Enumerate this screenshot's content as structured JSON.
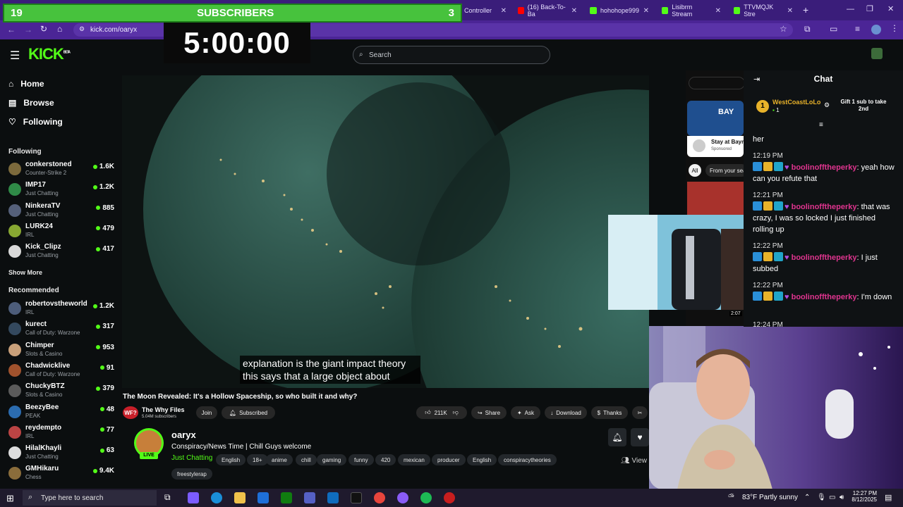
{
  "browser": {
    "tabs": [
      {
        "label": "Controller",
        "color": "#4a4a4a"
      },
      {
        "label": "(16) Back-To-Ba",
        "color": "#ff0000"
      },
      {
        "label": "hohohope999",
        "color": "#53fc18"
      },
      {
        "label": "Lisibrm Stream",
        "color": "#53fc18"
      },
      {
        "label": "TTVMQJK Stre",
        "color": "#53fc18"
      }
    ],
    "url": "kick.com/oaryx"
  },
  "overlay": {
    "sub_left": "19",
    "sub_title": "SUBSCRIBERS",
    "sub_right": "3",
    "timer": "5:00:00"
  },
  "kick": {
    "search_placeholder": "Search",
    "nav": [
      "Home",
      "Browse",
      "Following"
    ],
    "following_title": "Following",
    "following": [
      {
        "name": "conkerstoned",
        "game": "Counter-Strike 2",
        "viewers": "1.6K",
        "color": "#7c6a3c"
      },
      {
        "name": "IMP17",
        "game": "Just Chatting",
        "viewers": "1.2K",
        "color": "#2f8a47"
      },
      {
        "name": "NinkeraTV",
        "game": "Just Chatting",
        "viewers": "885",
        "color": "#55607a"
      },
      {
        "name": "LURK24",
        "game": "IRL",
        "viewers": "479",
        "color": "#88a832"
      },
      {
        "name": "Kick_Clipz",
        "game": "Just Chatting",
        "viewers": "417",
        "color": "#d9d9d9"
      }
    ],
    "show_more": "Show More",
    "recommended_title": "Recommended",
    "recommended": [
      {
        "name": "robertovstheworld",
        "game": "IRL",
        "viewers": "1.2K",
        "color": "#4d5d7a"
      },
      {
        "name": "kurect",
        "game": "Call of Duty: Warzone",
        "viewers": "317",
        "color": "#34495e"
      },
      {
        "name": "Chimper",
        "game": "Slots & Casino",
        "viewers": "953",
        "color": "#c9a07a"
      },
      {
        "name": "Chadwicklive",
        "game": "Call of Duty: Warzone",
        "viewers": "91",
        "color": "#a0522d"
      },
      {
        "name": "ChuckyBTZ",
        "game": "Slots & Casino",
        "viewers": "379",
        "color": "#5b5b5b"
      },
      {
        "name": "BeezyBee",
        "game": "PEAK",
        "viewers": "48",
        "color": "#2b6cb0"
      },
      {
        "name": "reydempto",
        "game": "IRL",
        "viewers": "77",
        "color": "#b44"
      },
      {
        "name": "HilalKhayli",
        "game": "Just Chatting",
        "viewers": "63",
        "color": "#ddd"
      },
      {
        "name": "GMHikaru",
        "game": "Chess",
        "viewers": "9.4K",
        "color": "#8a6d3b"
      }
    ],
    "streamer": {
      "name": "oaryx",
      "title": "Conspiracy/News Time | Chill Guys welcome",
      "category": "Just Chatting",
      "live_badge": "LIVE",
      "tags": [
        "English",
        "18+",
        "anime",
        "chill",
        "gaming",
        "funny",
        "420",
        "mexican",
        "producer",
        "English",
        "conspiracytheories",
        "freestylerap"
      ],
      "viewers_label": "View"
    }
  },
  "youtube": {
    "caption_line1": "explanation is the giant impact theory",
    "caption_line2": "this says that a large object about",
    "video_title": "The Moon Revealed: It's a Hollow Spaceship, so who built it and why?",
    "channel": "The Why Files",
    "subs": "5.04M subscribers",
    "join": "Join",
    "subscribed": "Subscribed",
    "likes": "211K",
    "share": "Share",
    "ask": "Ask",
    "download": "Download",
    "thanks": "Thanks",
    "side_ad_title": "Stay at Bayr",
    "side_ad_sponsored": "Sponsored",
    "side_chip_all": "All",
    "side_chip_from": "From your sea",
    "side_duration": "2:07"
  },
  "chat": {
    "title": "Chat",
    "pinned_user": "WestCoastLoLo",
    "pinned_count": "1",
    "pinned_rank": "1",
    "gift_text": "Gift 1 sub to take 2nd",
    "partial_text": "her",
    "messages": [
      {
        "time": "12:19 PM",
        "user": "boolinofftheperky",
        "text": ": yeah how can you refute that"
      },
      {
        "time": "12:21 PM",
        "user": "boolinofftheperky",
        "text": ": that was crazy, I was so locked I just finished rolling up"
      },
      {
        "time": "12:22 PM",
        "user": "boolinofftheperky",
        "text": ": I just subbed"
      },
      {
        "time": "12:22 PM",
        "user": "boolinofftheperky",
        "text": ": I'm down"
      }
    ],
    "last_time": "12:24 PM"
  },
  "taskbar": {
    "search_placeholder": "Type here to search",
    "weather": "83°F  Partly sunny",
    "time": "12:27 PM",
    "date": "8/12/2025"
  }
}
